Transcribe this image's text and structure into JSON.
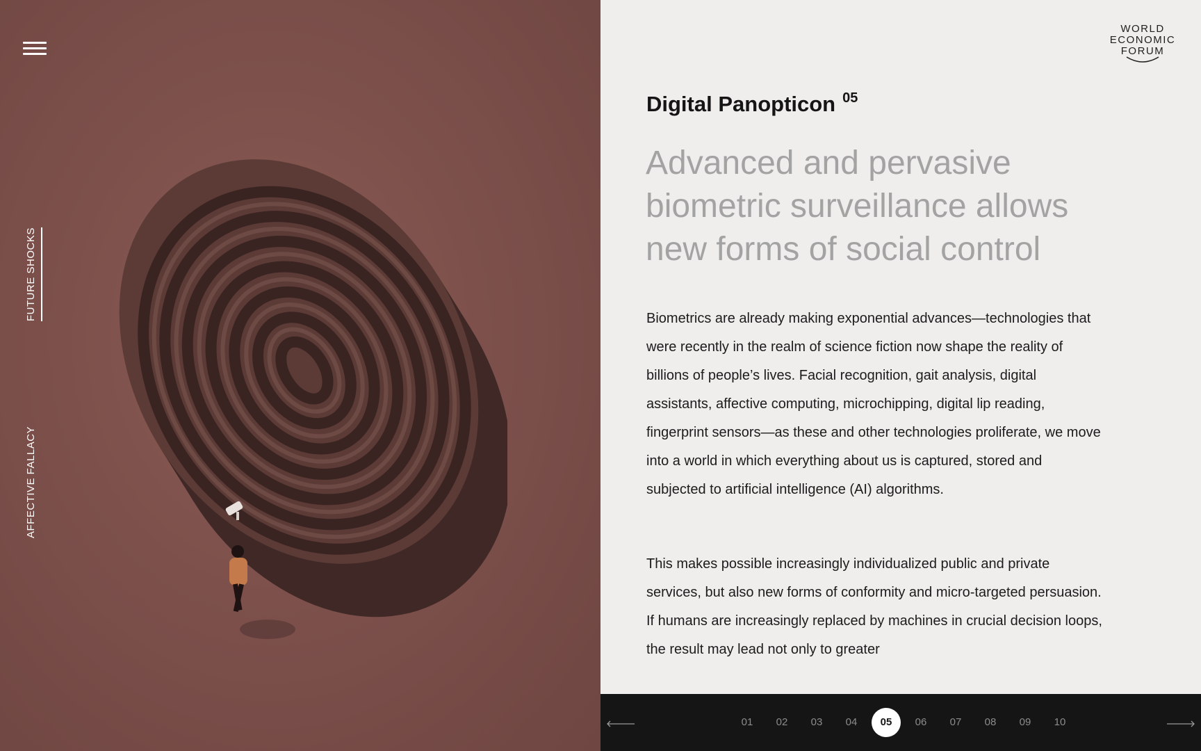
{
  "sidebar": {
    "menu_icon": "hamburger-icon",
    "vertical_labels": [
      {
        "label": "FUTURE SHOCKS",
        "active": true
      },
      {
        "label": "AFFECTIVE FALLACY",
        "active": false
      }
    ]
  },
  "logo": {
    "line1": "WORLD",
    "line2": "ECONOMIC",
    "line3": "FORUM"
  },
  "article": {
    "title": "Digital Panopticon",
    "number": "05",
    "headline": "Advanced and pervasive biometric surveillance allows new forms of social control",
    "paragraphs": [
      "Biometrics are already making exponential advances—technologies that were recently in the realm of science fiction now shape the reality of billions of people’s lives. Facial recognition, gait analysis, digital assistants, affective computing, microchipping, digital lip reading, fingerprint sensors—as these and other technologies proliferate, we move into a world in which everything about us is captured, stored and subjected to artificial intelligence (AI) algorithms.",
      "This makes possible increasingly individualized public and private services, but also new forms of conformity and micro-targeted persuasion. If humans are increasingly replaced by machines in crucial decision loops, the result may lead not only to greater"
    ]
  },
  "pagination": {
    "pages": [
      "01",
      "02",
      "03",
      "04",
      "05",
      "06",
      "07",
      "08",
      "09",
      "10"
    ],
    "active": "05",
    "prev_icon": "arrow-left-icon",
    "next_icon": "arrow-right-icon"
  },
  "colors": {
    "left_panel": "#7d504b",
    "right_panel": "#efeeec",
    "nav_bar": "#151515",
    "headline": "#a3a3a3"
  }
}
